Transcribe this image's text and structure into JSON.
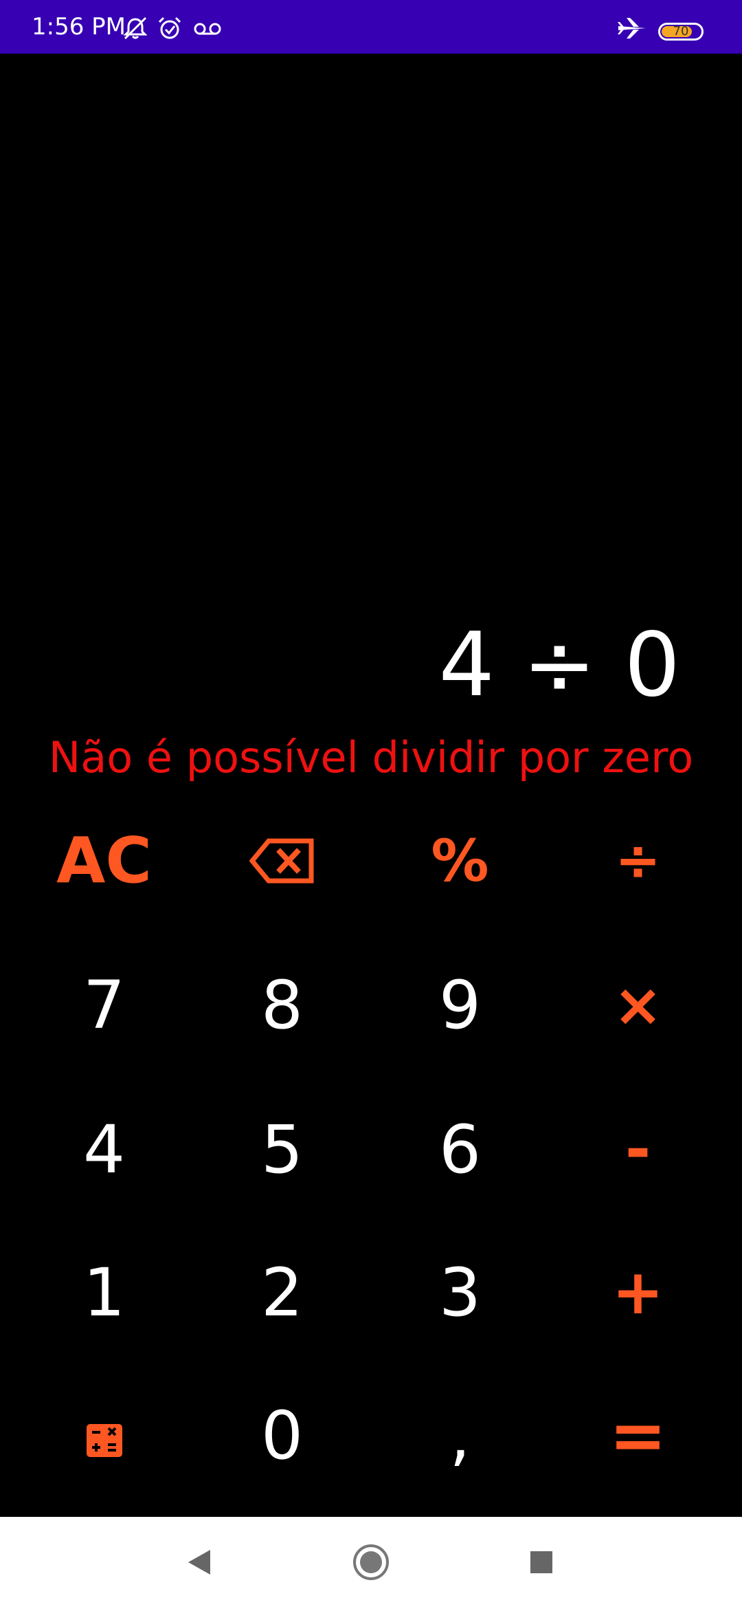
{
  "status_bar": {
    "time": "1:56 PM",
    "battery": "70",
    "icons": [
      "bell-off-icon",
      "alarm-icon",
      "voicemail-icon",
      "airplane-icon",
      "battery-icon"
    ],
    "background_color": "#3700b3",
    "battery_color": "#f5a623"
  },
  "display": {
    "expression": "4 ÷ 0",
    "error": "Não é possível dividir por zero",
    "error_color": "#ee1111"
  },
  "keypad": {
    "accent_color": "#ff5722",
    "keys": {
      "ac": "AC",
      "backspace": "backspace-icon",
      "percent": "%",
      "divide": "÷",
      "seven": "7",
      "eight": "8",
      "nine": "9",
      "multiply": "×",
      "four": "4",
      "five": "5",
      "six": "6",
      "minus": "-",
      "one": "1",
      "two": "2",
      "three": "3",
      "plus": "+",
      "calculator": "calculator-icon",
      "zero": "0",
      "comma": ",",
      "equals": "="
    }
  },
  "nav_bar": {
    "buttons": [
      "back-icon",
      "home-icon",
      "recents-icon"
    ]
  }
}
